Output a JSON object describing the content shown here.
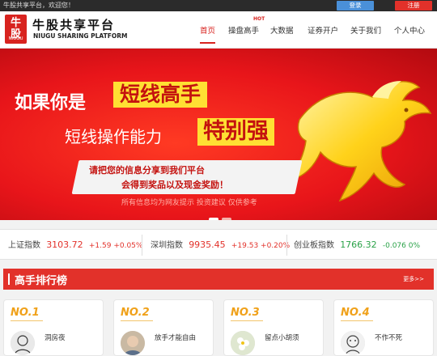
{
  "topbar": {
    "welcome": "牛股共享平台，欢迎您！",
    "login_label": "登录",
    "register_label": "注册"
  },
  "logo": {
    "mark_glyph": "牛股",
    "mark_sub": "NIUGU",
    "name_cn": "牛股共享平台",
    "name_en": "NIUGU SHARING PLATFORM"
  },
  "nav": {
    "items": [
      {
        "label": "首页",
        "active": true
      },
      {
        "label": "操盘高手",
        "active": false
      },
      {
        "label": "大数据",
        "active": false
      },
      {
        "label": "证券开户",
        "active": false
      },
      {
        "label": "关于我们",
        "active": false
      },
      {
        "label": "个人中心",
        "active": false
      }
    ],
    "hot_badge": "HOT"
  },
  "banner": {
    "line1_prefix": "如果你是",
    "line1_highlight": "短线高手",
    "line2_prefix": "短线操作能力",
    "line2_highlight": "特别强",
    "ribbon_line1": "请把您的信息分享到我们平台",
    "ribbon_line2": "会得到奖品以及现金奖励！",
    "disclaimer": "所有信息均为网友提示  投资建议  仅供参考",
    "slide_count": 2,
    "active_slide": 1
  },
  "indices": [
    {
      "name": "上证指数",
      "value": "3103.72",
      "change": "+1.59 +0.05%",
      "trend": "up"
    },
    {
      "name": "深圳指数",
      "value": "9935.45",
      "change": "+19.53 +0.20%",
      "trend": "up"
    },
    {
      "name": "创业板指数",
      "value": "1766.32",
      "change": "-0.076 0%",
      "trend": "down"
    }
  ],
  "ranking": {
    "title": "高手排行榜",
    "more_label": "更多>>",
    "cards": [
      {
        "rank": "NO.1",
        "name": "洞房夜"
      },
      {
        "rank": "NO.2",
        "name": "放手才能自由"
      },
      {
        "rank": "NO.3",
        "name": "留点小胡须"
      },
      {
        "rank": "NO.4",
        "name": "不作不死"
      }
    ]
  },
  "colors": {
    "brand_red": "#e2312a",
    "highlight_yellow": "#ffe033",
    "up": "#e2312a",
    "down": "#2aa248",
    "rank_gold": "#f0a11a"
  }
}
